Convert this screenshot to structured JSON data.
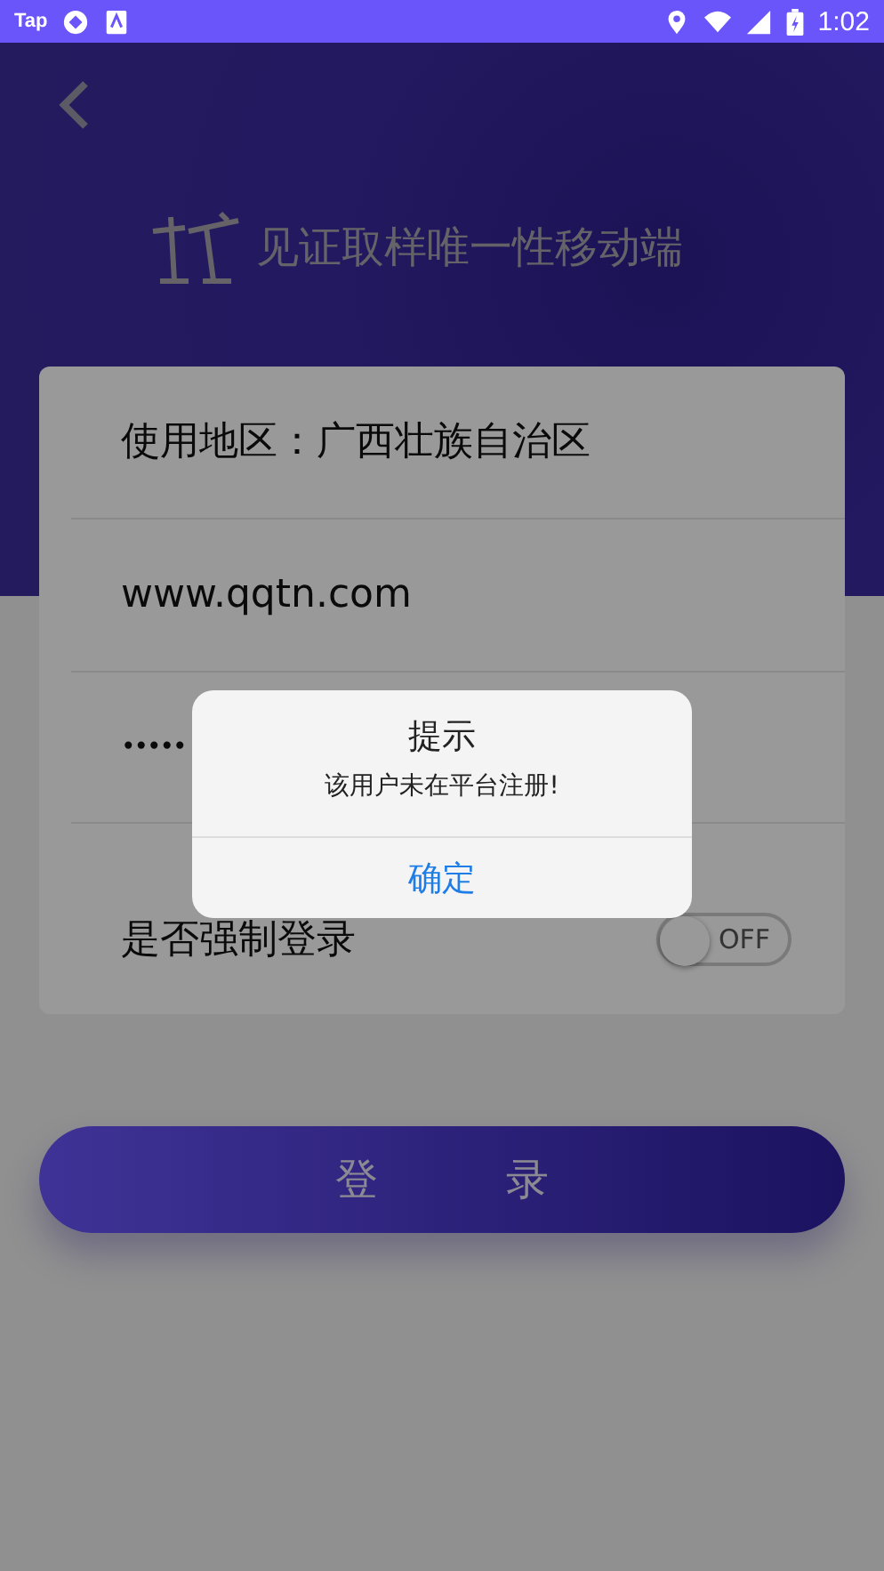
{
  "status_bar": {
    "apps": [
      "Tap"
    ],
    "time": "1:02"
  },
  "header": {
    "title": "见证取样唯一性移动端"
  },
  "form": {
    "rows": [
      {
        "kind": "text",
        "value": "使用地区：广西壮族自治区"
      },
      {
        "kind": "text",
        "value": "www.qqtn.com"
      },
      {
        "kind": "password",
        "value": "•••••"
      },
      {
        "kind": "toggle",
        "label": "是否强制登录",
        "on": false,
        "state_label": "OFF"
      }
    ]
  },
  "login_button": "登　　　录",
  "dialog": {
    "title": "提示",
    "message": "该用户未在平台注册!",
    "button": "确定"
  }
}
